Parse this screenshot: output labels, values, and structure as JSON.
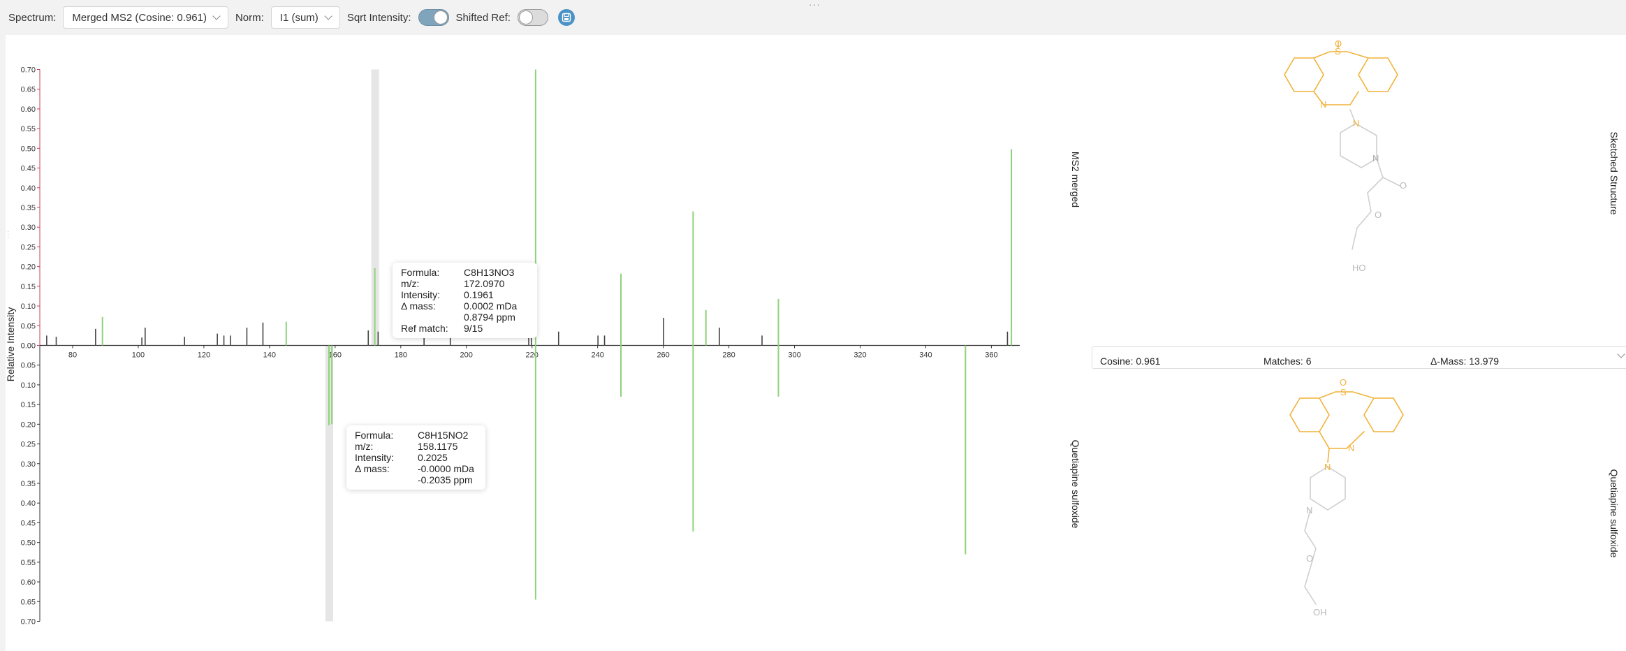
{
  "toolbar": {
    "spectrum_label": "Spectrum:",
    "spectrum_value": "Merged MS2 (Cosine: 0.961)",
    "norm_label": "Norm:",
    "norm_value": "I1 (sum)",
    "sqrt_label": "Sqrt Intensity:",
    "sqrt_on": true,
    "shifted_label": "Shifted Ref:",
    "shifted_on": false,
    "accent": "#4b92c7"
  },
  "panels": {
    "top_label": "MS2 merged",
    "bottom_label": "Quetiapine sulfoxide",
    "sketched_label": "Sketched Structure",
    "ref_struct_label": "Quetiapine sulfoxide"
  },
  "match_summary": {
    "cosine": "Cosine: 0.961",
    "matches": "Matches: 6",
    "delta_mass": "Δ-Mass: 13.979"
  },
  "tooltip_top": {
    "rows": [
      {
        "k": "Formula:",
        "v": "C8H13NO3"
      },
      {
        "k": "m/z:",
        "v": "172.0970"
      },
      {
        "k": "Intensity:",
        "v": "0.1961"
      },
      {
        "k": "Δ mass:",
        "v": "0.0002 mDa"
      },
      {
        "k": "",
        "v": "0.8794 ppm"
      },
      {
        "k": "Ref match:",
        "v": "9/15"
      }
    ]
  },
  "tooltip_bottom": {
    "rows": [
      {
        "k": "Formula:",
        "v": "C8H15NO2"
      },
      {
        "k": "m/z:",
        "v": "158.1175"
      },
      {
        "k": "Intensity:",
        "v": "0.2025"
      },
      {
        "k": "Δ mass:",
        "v": "-0.0000 mDa"
      },
      {
        "k": "",
        "v": "-0.2035 ppm"
      }
    ]
  },
  "structure_labels": {
    "S": "S",
    "O": "O",
    "N": "N",
    "HO": "HO",
    "OH": "OH"
  },
  "chart_data": {
    "type": "bar",
    "mirror": true,
    "title": "",
    "xlabel": "",
    "ylabel": "Relative Intensity",
    "xlim": [
      70,
      368
    ],
    "xticks": [
      80,
      100,
      120,
      140,
      160,
      180,
      200,
      220,
      240,
      260,
      280,
      300,
      320,
      340,
      360
    ],
    "ylim": [
      0,
      0.7
    ],
    "yticks": [
      "0.00",
      "0.05",
      "0.10",
      "0.15",
      "0.20",
      "0.25",
      "0.30",
      "0.35",
      "0.40",
      "0.45",
      "0.50",
      "0.55",
      "0.60",
      "0.65",
      "0.70"
    ],
    "colors": {
      "matched": "#8fd27a",
      "unmatched": "#444444",
      "highlight": "#e6e6e6",
      "axis_top": "#d23c5a"
    },
    "highlights": [
      {
        "panel": "top",
        "x": 172.097
      },
      {
        "panel": "bottom",
        "x": 158.1175
      }
    ],
    "top_series": {
      "name": "MS2 merged",
      "peaks": [
        {
          "x": 72.1,
          "y": 0.025,
          "matched": false
        },
        {
          "x": 75.0,
          "y": 0.022,
          "matched": false
        },
        {
          "x": 87.0,
          "y": 0.042,
          "matched": false
        },
        {
          "x": 89.1,
          "y": 0.072,
          "matched": true
        },
        {
          "x": 101.1,
          "y": 0.02,
          "matched": false
        },
        {
          "x": 102.1,
          "y": 0.045,
          "matched": false
        },
        {
          "x": 114.1,
          "y": 0.022,
          "matched": false
        },
        {
          "x": 124.1,
          "y": 0.03,
          "matched": false
        },
        {
          "x": 126.1,
          "y": 0.025,
          "matched": false
        },
        {
          "x": 128.1,
          "y": 0.025,
          "matched": false
        },
        {
          "x": 133.1,
          "y": 0.045,
          "matched": false
        },
        {
          "x": 138.0,
          "y": 0.058,
          "matched": false
        },
        {
          "x": 145.1,
          "y": 0.06,
          "matched": true
        },
        {
          "x": 170.1,
          "y": 0.038,
          "matched": false
        },
        {
          "x": 172.097,
          "y": 0.1961,
          "matched": true
        },
        {
          "x": 173.1,
          "y": 0.035,
          "matched": false
        },
        {
          "x": 187.1,
          "y": 0.025,
          "matched": false
        },
        {
          "x": 195.1,
          "y": 0.022,
          "matched": false
        },
        {
          "x": 219.0,
          "y": 0.025,
          "matched": false
        },
        {
          "x": 219.8,
          "y": 0.03,
          "matched": false
        },
        {
          "x": 221.1,
          "y": 0.7,
          "matched": true
        },
        {
          "x": 228.1,
          "y": 0.035,
          "matched": false
        },
        {
          "x": 240.1,
          "y": 0.025,
          "matched": false
        },
        {
          "x": 242.1,
          "y": 0.025,
          "matched": false
        },
        {
          "x": 247.1,
          "y": 0.182,
          "matched": true
        },
        {
          "x": 260.1,
          "y": 0.07,
          "matched": false
        },
        {
          "x": 269.1,
          "y": 0.34,
          "matched": true
        },
        {
          "x": 273.0,
          "y": 0.09,
          "matched": true
        },
        {
          "x": 277.1,
          "y": 0.045,
          "matched": false
        },
        {
          "x": 290.1,
          "y": 0.025,
          "matched": false
        },
        {
          "x": 295.1,
          "y": 0.118,
          "matched": true
        },
        {
          "x": 364.9,
          "y": 0.035,
          "matched": false
        },
        {
          "x": 366.1,
          "y": 0.498,
          "matched": true
        }
      ]
    },
    "bottom_series": {
      "name": "Quetiapine sulfoxide",
      "peaks": [
        {
          "x": 158.1175,
          "y": 0.2025,
          "matched": true
        },
        {
          "x": 159.0,
          "y": 0.2,
          "matched": true
        },
        {
          "x": 221.1,
          "y": 0.645,
          "matched": true
        },
        {
          "x": 247.1,
          "y": 0.13,
          "matched": true
        },
        {
          "x": 269.1,
          "y": 0.472,
          "matched": true
        },
        {
          "x": 295.1,
          "y": 0.13,
          "matched": true
        },
        {
          "x": 352.1,
          "y": 0.53,
          "matched": true
        }
      ]
    }
  }
}
